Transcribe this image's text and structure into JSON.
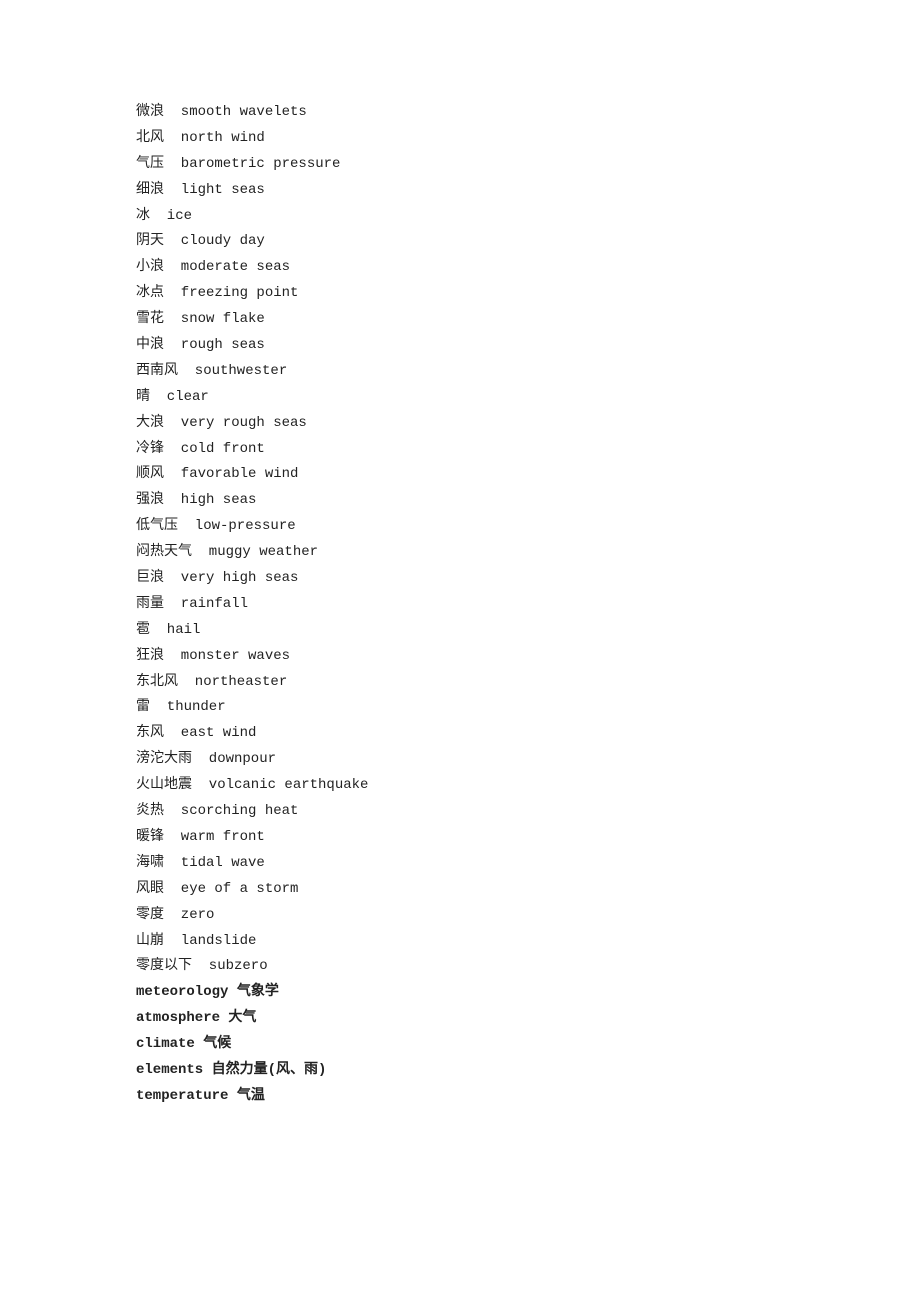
{
  "vocab": {
    "items": [
      {
        "chinese": "微浪",
        "english": "smooth wavelets"
      },
      {
        "chinese": "北风",
        "english": "north wind"
      },
      {
        "chinese": "气压",
        "english": "barometric pressure"
      },
      {
        "chinese": "细浪",
        "english": "light seas"
      },
      {
        "chinese": "冰",
        "english": "ice"
      },
      {
        "chinese": "阴天",
        "english": "cloudy day"
      },
      {
        "chinese": "小浪",
        "english": "moderate seas"
      },
      {
        "chinese": "冰点",
        "english": "freezing point"
      },
      {
        "chinese": "雪花",
        "english": "snow flake"
      },
      {
        "chinese": "中浪",
        "english": "rough seas"
      },
      {
        "chinese": "西南风",
        "english": "southwester"
      },
      {
        "chinese": "晴",
        "english": "clear"
      },
      {
        "chinese": "大浪",
        "english": "very rough seas"
      },
      {
        "chinese": "冷锋",
        "english": "cold front"
      },
      {
        "chinese": "顺风",
        "english": "favorable wind"
      },
      {
        "chinese": "强浪",
        "english": "high seas"
      },
      {
        "chinese": "低气压",
        "english": "low-pressure"
      },
      {
        "chinese": "闷热天气",
        "english": "muggy weather"
      },
      {
        "chinese": "巨浪",
        "english": "very high seas"
      },
      {
        "chinese": "雨量",
        "english": "rainfall"
      },
      {
        "chinese": "雹",
        "english": "hail"
      },
      {
        "chinese": "狂浪",
        "english": "monster waves"
      },
      {
        "chinese": "东北风",
        "english": "northeaster"
      },
      {
        "chinese": "雷",
        "english": "thunder"
      },
      {
        "chinese": "东风",
        "english": "east wind"
      },
      {
        "chinese": "滂沱大雨",
        "english": "downpour"
      },
      {
        "chinese": "火山地震",
        "english": "volcanic earthquake"
      },
      {
        "chinese": "炎热",
        "english": "scorching heat"
      },
      {
        "chinese": "暖锋",
        "english": "warm front"
      },
      {
        "chinese": "海啸",
        "english": "tidal wave"
      },
      {
        "chinese": "风眼",
        "english": "eye of a storm"
      },
      {
        "chinese": "零度",
        "english": "zero"
      },
      {
        "chinese": "山崩",
        "english": "landslide"
      },
      {
        "chinese": "零度以下",
        "english": "subzero"
      }
    ],
    "extra_items": [
      {
        "english": "meteorology",
        "chinese": "气象学"
      },
      {
        "english": "atmosphere",
        "chinese": "大气"
      },
      {
        "english": "climate",
        "chinese": "气候"
      },
      {
        "english": "elements",
        "chinese": "自然力量(风、雨)"
      },
      {
        "english": "temperature",
        "chinese": "气温"
      }
    ]
  }
}
